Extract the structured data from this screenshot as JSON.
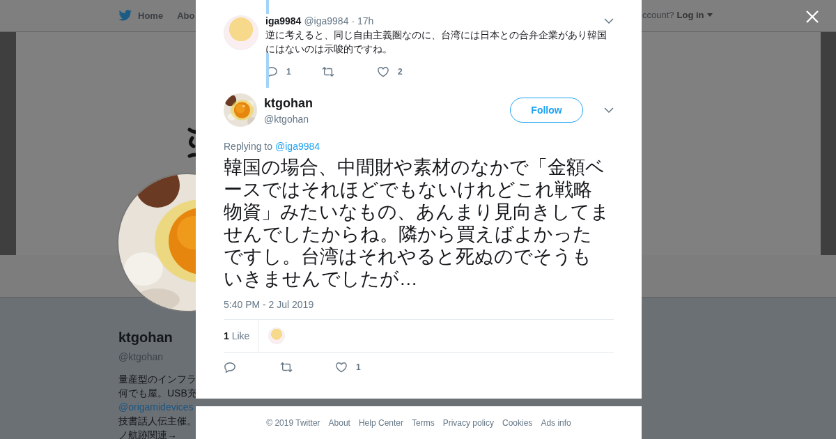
{
  "nav": {
    "items": [
      {
        "label": "Home"
      },
      {
        "label": "Abo"
      }
    ],
    "account_prompt": "ccount?",
    "login": "Log in"
  },
  "profile": {
    "name": "ktgohan",
    "handle": "@ktgohan",
    "bio": [
      [
        {
          "kind": "text",
          "text": "量産型のインフラ"
        }
      ],
      [
        {
          "kind": "text",
          "text": "何でも屋。USB充"
        }
      ],
      [
        {
          "kind": "link",
          "text": "@origamidevices"
        }
      ],
      [
        {
          "kind": "text",
          "text": "技書話人伝主催。"
        }
      ],
      [
        {
          "kind": "text",
          "text": "ノ航跡関連→"
        }
      ]
    ]
  },
  "modal": {
    "parent_tweet": {
      "name": "iga9984",
      "handle": "@iga9984",
      "time": "· 17h",
      "text": "逆に考えると、同じ自由主義圏なのに、台湾には日本との合弁企業があり韓国にはないのは示唆的ですね。",
      "replies": "1",
      "likes": "2"
    },
    "tweet": {
      "name": "ktgohan",
      "handle": "@ktgohan",
      "follow": "Follow",
      "replying_label": "Replying to",
      "replying_to": "@iga9984",
      "text_lines": [
        "韓国の場合、中間財や素材のなかで「金額ベ",
        "ースではそれほどでもないけれどこれ戦略",
        "物資」みたいなもの、あんまり見向きしてま",
        "せんでしたからね。隣から買えばよかった",
        "ですし。台湾はそれやると死ぬのでそうも",
        "いきませんでしたが…"
      ],
      "time": "5:40 PM - 2 Jul 2019",
      "like_stat": "**1** Like",
      "likes": "1"
    }
  },
  "footer": {
    "links": [
      "© 2019 Twitter",
      "About",
      "Help Center",
      "Terms",
      "Privacy policy",
      "Cookies",
      "Ads info"
    ]
  }
}
